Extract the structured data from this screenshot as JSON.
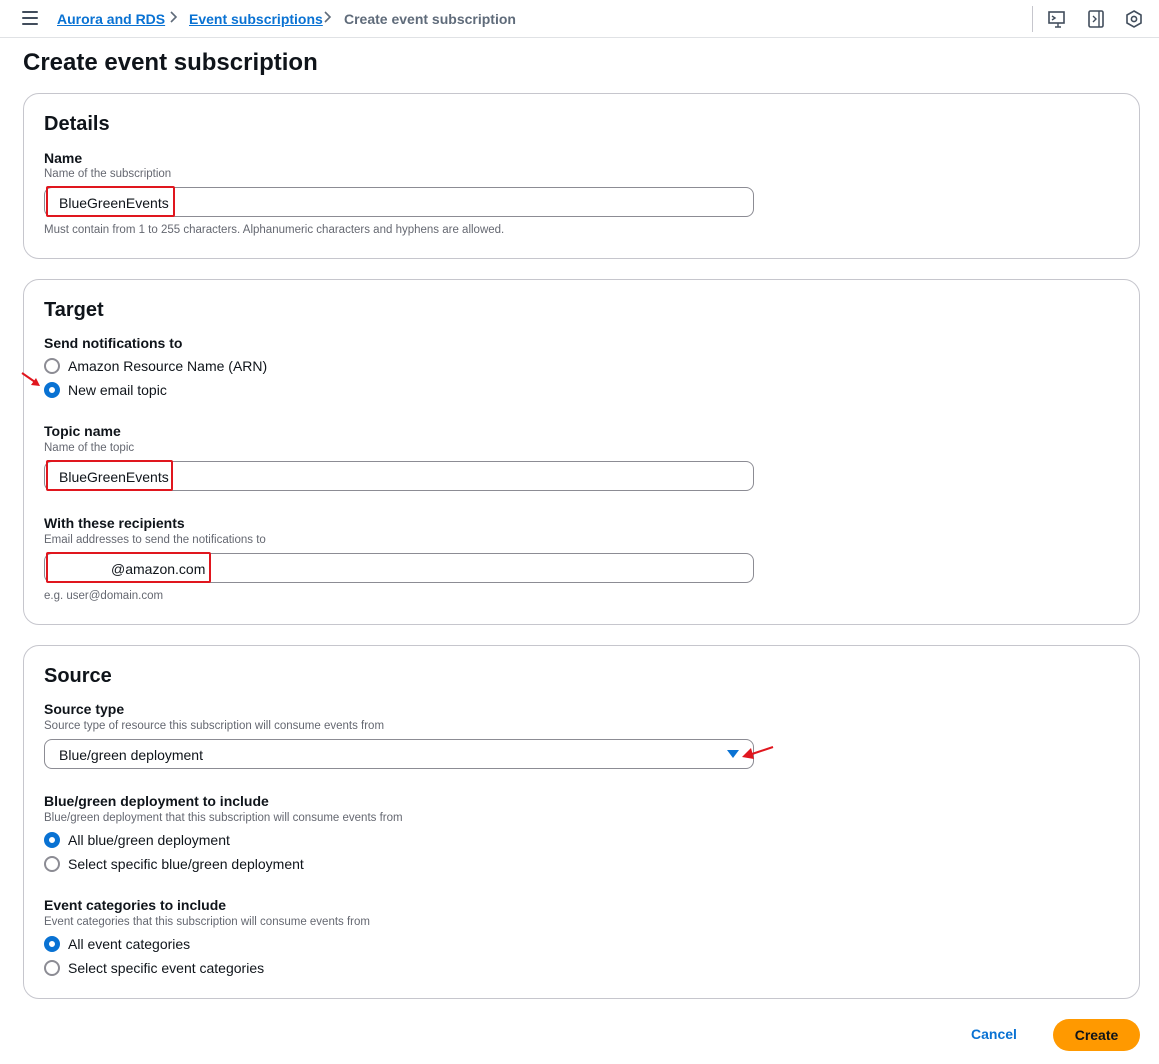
{
  "breadcrumb": {
    "items": [
      "Aurora and RDS",
      "Event subscriptions"
    ],
    "current": "Create event subscription"
  },
  "page_title": "Create event subscription",
  "details": {
    "title": "Details",
    "name_label": "Name",
    "name_desc": "Name of the subscription",
    "name_value": "BlueGreenEvents",
    "name_hint": "Must contain from 1 to 255 characters. Alphanumeric characters and hyphens are allowed."
  },
  "target": {
    "title": "Target",
    "send_label": "Send notifications to",
    "options": [
      "Amazon Resource Name (ARN)",
      "New email topic"
    ],
    "selected": "New email topic",
    "topic_label": "Topic name",
    "topic_desc": "Name of the topic",
    "topic_value": "BlueGreenEvents",
    "recipients_label": "With these recipients",
    "recipients_desc": "Email addresses to send the notifications to",
    "recipients_value": "@amazon.com",
    "recipients_hint": "e.g. user@domain.com"
  },
  "source": {
    "title": "Source",
    "type_label": "Source type",
    "type_desc": "Source type of resource this subscription will consume events from",
    "type_value": "Blue/green deployment",
    "bg_label": "Blue/green deployment to include",
    "bg_desc": "Blue/green deployment that this subscription will consume events from",
    "bg_options": [
      "All blue/green deployment",
      "Select specific blue/green deployment"
    ],
    "bg_selected": "All blue/green deployment",
    "cat_label": "Event categories to include",
    "cat_desc": "Event categories that this subscription will consume events from",
    "cat_options": [
      "All event categories",
      "Select specific event categories"
    ],
    "cat_selected": "All event categories"
  },
  "actions": {
    "cancel": "Cancel",
    "create": "Create"
  },
  "colors": {
    "link": "#0972d3",
    "primary_button": "#ff9900",
    "annotation": "#e0161e"
  },
  "icons": [
    "menu-icon",
    "cloudshell-icon",
    "side-panel-icon",
    "settings-hex-icon",
    "chevron-right-icon",
    "caret-down-icon"
  ]
}
